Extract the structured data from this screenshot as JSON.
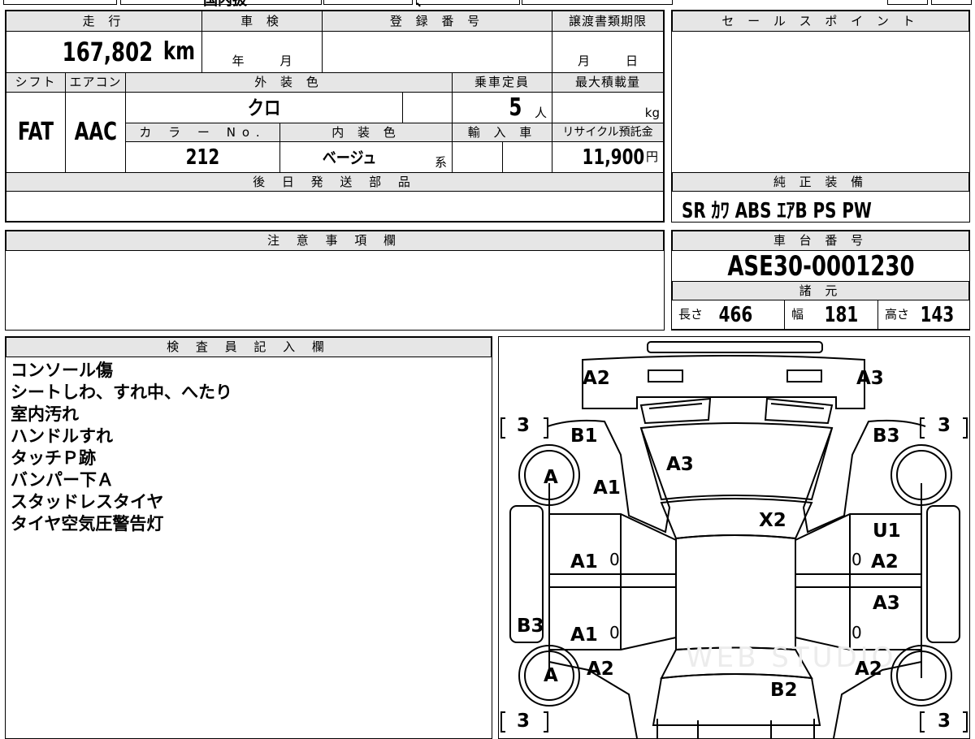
{
  "top_row": {
    "left_text": "国内扱",
    "mid_text": "、"
  },
  "vehicle": {
    "mileage_header": "走 行",
    "mileage": "167,802",
    "mileage_unit": "km",
    "inspection_header": "車 検",
    "inspection_year_unit": "年",
    "inspection_month_unit": "月",
    "registration_header": "登 録 番 号",
    "registration_value": "",
    "transfer_header": "譲渡書類期限",
    "transfer_month_unit": "月",
    "transfer_day_unit": "日",
    "shift_header": "シフト",
    "shift": "FAT",
    "ac_header": "エアコン",
    "ac": "AAC",
    "exterior_header": "外 装 色",
    "exterior_color": "クロ",
    "capacity_header": "乗車定員",
    "capacity": "5",
    "capacity_unit": "人",
    "max_load_header": "最大積載量",
    "max_load_unit": "kg",
    "color_no_header": "カ ラ ー No.",
    "color_no": "212",
    "interior_header": "内 装 色",
    "interior_color": "ベージュ",
    "interior_suffix": "系",
    "import_header": "輸 入 車",
    "recycle_header": "リサイクル預託金",
    "recycle_fee": "11,900",
    "recycle_unit": "円",
    "later_parts_header": "後 日 発 送 部 品"
  },
  "sales_point": {
    "header": "セ ー ル ス ポ イ ン ト"
  },
  "equipment": {
    "header": "純 正 装 備",
    "items": "SR ｶﾜ ABS ｴｱB PS PW"
  },
  "notes": {
    "header": "注 意 事 項 欄"
  },
  "chassis": {
    "header": "車 台 番 号",
    "number": "ASE30-0001230"
  },
  "specs": {
    "header": "諸 元",
    "length_label": "長さ",
    "length": "466",
    "width_label": "幅",
    "width": "181",
    "height_label": "高さ",
    "height": "143"
  },
  "inspector": {
    "header": "検 査 員 記 入 欄",
    "lines": [
      "コンソール傷",
      "シートしわ、すれ中、へたり",
      "室内汚れ",
      "ハンドルすれ",
      "タッチＰ跡",
      "バンパー下Ａ",
      "スタッドレスタイヤ",
      "タイヤ空気圧警告灯"
    ]
  },
  "diagram": {
    "labels": {
      "front_left_corner": "A2",
      "front_right_corner": "A3",
      "front_left_fender": "B1",
      "front_right_fender": "B3",
      "windshield_hood": "A3",
      "left_wheel_front": "A",
      "left_front_fender_low": "A1",
      "roof_area": "X2",
      "right_front_door_top": "U1",
      "left_front_door": "A1",
      "right_front_door": "A2",
      "right_rear_door": "A3",
      "left_rear_quarter": "B3",
      "left_rear_door": "A1",
      "left_wheel_rear": "A",
      "left_rear_fender": "A2",
      "right_rear_fender": "A2",
      "trunk": "B2"
    },
    "tire_counts": {
      "front_left": "3",
      "front_right": "3",
      "rear_left": "3",
      "rear_right": "3"
    },
    "zero_marks": [
      "0",
      "0",
      "0",
      "0"
    ],
    "watermark": "WEB STUDIO"
  }
}
